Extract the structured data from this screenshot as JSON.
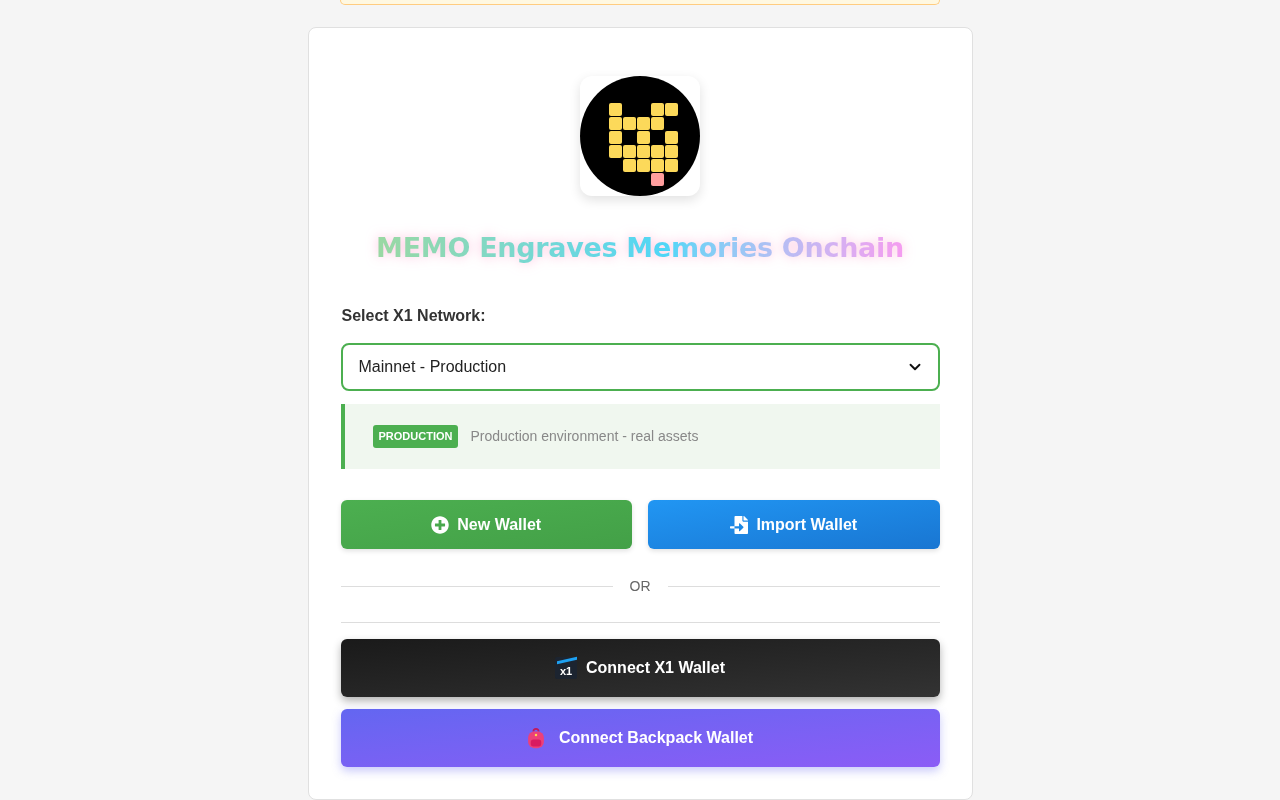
{
  "title": "MEMO Engraves Memories Onchain",
  "network": {
    "label": "Select X1 Network:",
    "value": "Mainnet - Production",
    "badge": "PRODUCTION",
    "description": "Production environment - real assets"
  },
  "wallet_actions": [
    {
      "label": "New Wallet",
      "kind": "create"
    },
    {
      "label": "Import Wallet",
      "kind": "import"
    }
  ],
  "divider": "OR",
  "connect_buttons": [
    {
      "label": "Connect X1 Wallet",
      "kind": "x1",
      "logo_text": "x1"
    },
    {
      "label": "Connect Backpack Wallet",
      "kind": "backpack"
    }
  ]
}
